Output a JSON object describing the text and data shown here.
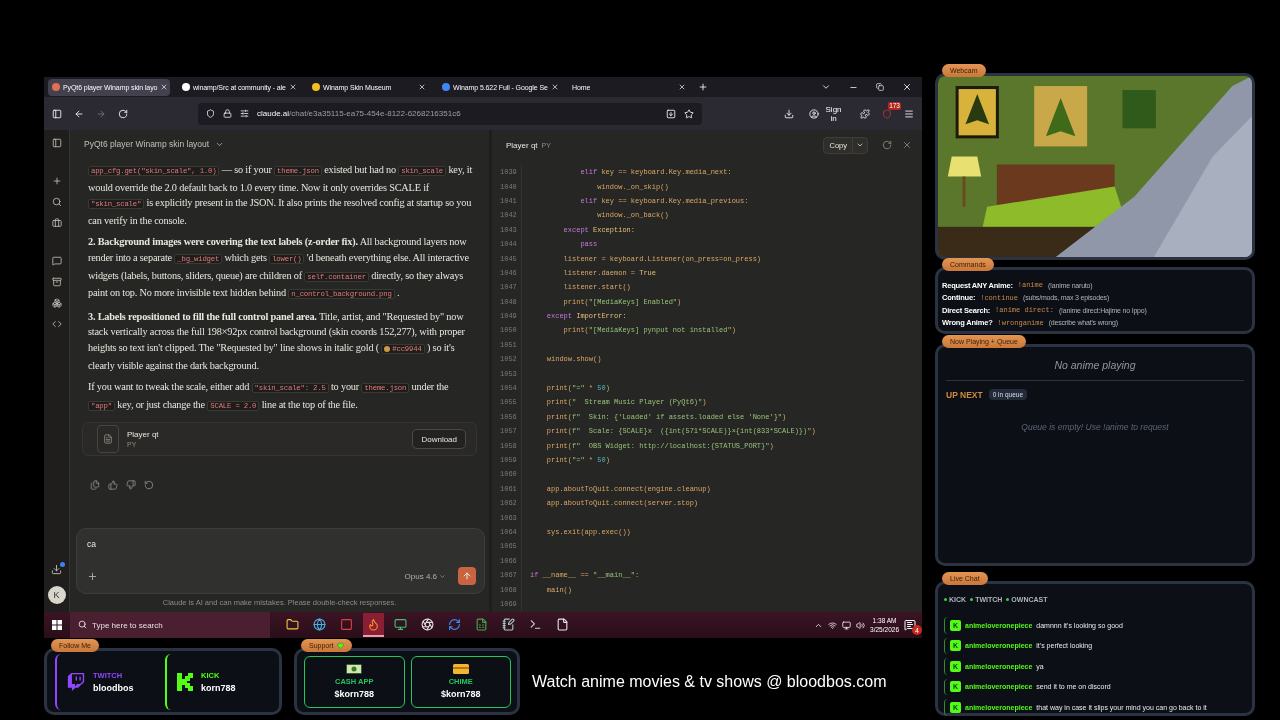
{
  "browser": {
    "tabs": [
      {
        "title": "PyQt6 player Winamp skin layo",
        "selected": true
      },
      {
        "title": "winamp/Src at community - ale",
        "selected": false
      },
      {
        "title": "Winamp Skin Museum",
        "selected": false
      },
      {
        "title": "Winamp 5.622 Full - Google Se",
        "selected": false
      },
      {
        "title": "Home",
        "selected": false
      }
    ],
    "address": {
      "host": "claude.ai",
      "path": "/chat/e3a35115-ea75-454e-8122-6268216351c6"
    },
    "sign_in": "Sign in",
    "extension_badge": "173"
  },
  "chat": {
    "title": "PyQt6 player Winamp skin layout",
    "paragraphs": [
      [
        {
          "text": "app_cfg.get(\"skin_scale\", 1.0)",
          "kind": "code"
        },
        {
          "text": " — so if your ",
          "kind": "text"
        },
        {
          "text": "theme.json",
          "kind": "code"
        },
        {
          "text": " existed but had no ",
          "kind": "text"
        },
        {
          "text": "skin_scale",
          "kind": "code"
        },
        {
          "text": " key, it would override the 2.0 default back to 1.0 every time. Now it only overrides SCALE if ",
          "kind": "text"
        },
        {
          "text": "\"skin_scale\"",
          "kind": "code"
        },
        {
          "text": " is explicitly present in the JSON. It also prints the resolved config at startup so you can verify in the console.",
          "kind": "text"
        }
      ],
      [
        {
          "text": "2. Background images were covering the text labels (z-order fix).",
          "kind": "bold"
        },
        {
          "text": " All background layers now render into a separate ",
          "kind": "text"
        },
        {
          "text": "_bg_widget",
          "kind": "code"
        },
        {
          "text": " which gets ",
          "kind": "text"
        },
        {
          "text": "lower()",
          "kind": "code"
        },
        {
          "text": " 'd beneath everything else. All interactive widgets (labels, buttons, sliders, queue) are children of ",
          "kind": "text"
        },
        {
          "text": "self.container",
          "kind": "code"
        },
        {
          "text": " directly, so they always paint on top. No more invisible text hidden behind ",
          "kind": "text"
        },
        {
          "text": "n_control_background.png",
          "kind": "code"
        },
        {
          "text": " .",
          "kind": "text"
        }
      ],
      [
        {
          "text": "3. Labels repositioned to fill the full control panel area.",
          "kind": "bold"
        },
        {
          "text": " Title, artist, and \"Requested by\" now stack vertically across the full 198×92px control background (skin coords 152,277), with proper heights so text isn't clipped. The \"Requested by\" line shows in italic gold ( ",
          "kind": "text"
        },
        {
          "text": "#cc9944",
          "kind": "swatch"
        },
        {
          "text": " ) so it's clearly visible against the dark background.",
          "kind": "text"
        }
      ],
      [
        {
          "text": "If you want to tweak the scale, either add ",
          "kind": "text"
        },
        {
          "text": "\"skin_scale\": 2.5",
          "kind": "code"
        },
        {
          "text": " to your ",
          "kind": "text"
        },
        {
          "text": "theme.json",
          "kind": "code"
        },
        {
          "text": " under the ",
          "kind": "text"
        },
        {
          "text": "\"app\"",
          "kind": "code"
        },
        {
          "text": " key, or just change the ",
          "kind": "text"
        },
        {
          "text": "SCALE = 2.0",
          "kind": "code"
        },
        {
          "text": " line at the top of the file.",
          "kind": "text"
        }
      ]
    ],
    "attachment": {
      "name": "Player qt",
      "type": "PY",
      "action": "Download"
    },
    "input": {
      "value": "ca",
      "model": "Opus 4.6"
    },
    "disclaimer": "Claude is AI and can make mistakes. Please double-check responses.",
    "avatar": "K"
  },
  "code_panel": {
    "title": "Player qt",
    "type": "PY",
    "copy": "Copy",
    "lines": [
      {
        "n": "1039",
        "tokens": [
          {
            "text": "            elif",
            "kind": "kw"
          },
          {
            "text": " key == keyboard.Key.media_next:",
            "kind": "id"
          }
        ]
      },
      {
        "n": "1040",
        "tokens": [
          {
            "text": "                window._on_skip()",
            "kind": "id"
          }
        ]
      },
      {
        "n": "1041",
        "tokens": [
          {
            "text": "            elif",
            "kind": "kw"
          },
          {
            "text": " key == keyboard.Key.media_previous:",
            "kind": "id"
          }
        ]
      },
      {
        "n": "1042",
        "tokens": [
          {
            "text": "                window._on_back()",
            "kind": "id"
          }
        ]
      },
      {
        "n": "1043",
        "tokens": [
          {
            "text": "        except",
            "kind": "kw"
          },
          {
            "text": " Exception:",
            "kind": "cls"
          }
        ]
      },
      {
        "n": "1044",
        "tokens": [
          {
            "text": "            pass",
            "kind": "kw"
          }
        ]
      },
      {
        "n": "1045",
        "tokens": [
          {
            "text": "        listener = keyboard.Listener(on_press=on_press)",
            "kind": "id"
          }
        ]
      },
      {
        "n": "1046",
        "tokens": [
          {
            "text": "        listener.daemon = ",
            "kind": "id"
          },
          {
            "text": "True",
            "kind": "cls"
          }
        ]
      },
      {
        "n": "1047",
        "tokens": [
          {
            "text": "        listener.start()",
            "kind": "id"
          }
        ]
      },
      {
        "n": "1048",
        "tokens": [
          {
            "text": "        print(",
            "kind": "id"
          },
          {
            "text": "\"[MediaKeys] Enabled\"",
            "kind": "str"
          },
          {
            "text": ")",
            "kind": "id"
          }
        ]
      },
      {
        "n": "1049",
        "tokens": [
          {
            "text": "    except",
            "kind": "kw"
          },
          {
            "text": " ImportError:",
            "kind": "cls"
          }
        ]
      },
      {
        "n": "1050",
        "tokens": [
          {
            "text": "        print(",
            "kind": "id"
          },
          {
            "text": "\"[MediaKeys] pynput not installed\"",
            "kind": "str"
          },
          {
            "text": ")",
            "kind": "id"
          }
        ]
      },
      {
        "n": "1051"
      },
      {
        "n": "1052",
        "tokens": [
          {
            "text": "    window.show()",
            "kind": "id"
          }
        ]
      },
      {
        "n": "1053"
      },
      {
        "n": "1054",
        "tokens": [
          {
            "text": "    print(",
            "kind": "id"
          },
          {
            "text": "\"=\"",
            "kind": "str"
          },
          {
            "text": " * ",
            "kind": "id"
          },
          {
            "text": "50",
            "kind": "num"
          },
          {
            "text": ")",
            "kind": "id"
          }
        ]
      },
      {
        "n": "1055",
        "tokens": [
          {
            "text": "    print(",
            "kind": "id"
          },
          {
            "text": "\"  Stream Music Player (PyQt6)\"",
            "kind": "str"
          },
          {
            "text": ")",
            "kind": "id"
          }
        ]
      },
      {
        "n": "1056",
        "tokens": [
          {
            "text": "    print(",
            "kind": "id"
          },
          {
            "text": "f\"  Skin: {'Loaded' if assets.loaded else 'None'}\"",
            "kind": "str"
          },
          {
            "text": ")",
            "kind": "id"
          }
        ]
      },
      {
        "n": "1057",
        "tokens": [
          {
            "text": "    print(",
            "kind": "id"
          },
          {
            "text": "f\"  Scale: {SCALE}x  ({int(571*SCALE)}×{int(833*SCALE)})\"",
            "kind": "str"
          },
          {
            "text": ")",
            "kind": "id"
          }
        ]
      },
      {
        "n": "1058",
        "tokens": [
          {
            "text": "    print(",
            "kind": "id"
          },
          {
            "text": "f\"  OBS Widget: http://localhost:{STATUS_PORT}\"",
            "kind": "str"
          },
          {
            "text": ")",
            "kind": "id"
          }
        ]
      },
      {
        "n": "1059",
        "tokens": [
          {
            "text": "    print(",
            "kind": "id"
          },
          {
            "text": "\"=\"",
            "kind": "str"
          },
          {
            "text": " * ",
            "kind": "id"
          },
          {
            "text": "50",
            "kind": "num"
          },
          {
            "text": ")",
            "kind": "id"
          }
        ]
      },
      {
        "n": "1060"
      },
      {
        "n": "1061",
        "tokens": [
          {
            "text": "    app.aboutToQuit.connect(engine.cleanup)",
            "kind": "id"
          }
        ]
      },
      {
        "n": "1062",
        "tokens": [
          {
            "text": "    app.aboutToQuit.connect(server.stop)",
            "kind": "id"
          }
        ]
      },
      {
        "n": "1063"
      },
      {
        "n": "1064",
        "tokens": [
          {
            "text": "    sys.exit(app.exec())",
            "kind": "id"
          }
        ]
      },
      {
        "n": "1065"
      },
      {
        "n": "1066"
      },
      {
        "n": "1067",
        "tokens": [
          {
            "text": "if",
            "kind": "kw"
          },
          {
            "text": " __name__ == ",
            "kind": "id"
          },
          {
            "text": "\"__main__\"",
            "kind": "str"
          },
          {
            "text": ":",
            "kind": "id"
          }
        ]
      },
      {
        "n": "1068",
        "tokens": [
          {
            "text": "    main()",
            "kind": "id"
          }
        ]
      },
      {
        "n": "1069"
      }
    ]
  },
  "taskbar": {
    "search_placeholder": "Type here to search",
    "apps": [
      {
        "kind": "folder",
        "selected": false
      },
      {
        "kind": "edge",
        "selected": false
      },
      {
        "kind": "voice",
        "selected": false
      },
      {
        "kind": "firefox",
        "selected": true
      },
      {
        "kind": "monitor",
        "selected": false
      },
      {
        "kind": "obs",
        "selected": false
      },
      {
        "kind": "refresh",
        "selected": false
      },
      {
        "kind": "sheet",
        "selected": false
      },
      {
        "kind": "notes",
        "selected": false
      },
      {
        "kind": "terminal",
        "selected": false
      },
      {
        "kind": "file",
        "selected": false
      }
    ],
    "time": "1:38 AM",
    "date": "3/25/2026",
    "notifications": "4"
  },
  "overlay": {
    "webcam": {
      "tag": "Webcam",
      "kind": "picture"
    },
    "commands": {
      "tag": "Commands",
      "rows": [
        {
          "label": "Request ANY Anime:",
          "command": "!anime",
          "hint": "(!anime naruto)"
        },
        {
          "label": "Continue:",
          "command": "!continue",
          "hint": "(subs/mods, max 3 episodes)"
        },
        {
          "label": "Direct Search:",
          "command": "!anime direct:",
          "hint": "(!anime direct:Hajime no Ippo)"
        },
        {
          "label": "Wrong Anime?",
          "command": "!wronganime",
          "hint": "(describe what's wrong)"
        }
      ]
    },
    "now_playing": {
      "tag": "Now Playing + Queue",
      "status": "No anime playing",
      "up_next": "UP NEXT",
      "queue_count": "0 in queue",
      "queue_empty": "Queue is empty! Use !anime to request"
    },
    "live_chat": {
      "tag": "Live Chat",
      "platforms": [
        "KICK",
        "TWITCH",
        "OWNCAST"
      ],
      "messages": [
        {
          "badge": "K",
          "user": "animeloveronepiece",
          "text": "damnnn it's looking so good"
        },
        {
          "badge": "K",
          "user": "animeloveronepiece",
          "text": "it's perfect looking"
        },
        {
          "badge": "K",
          "user": "animeloveronepiece",
          "text": "ya"
        },
        {
          "badge": "K",
          "user": "animeloveronepiece",
          "text": "send it to me on discord"
        },
        {
          "badge": "K",
          "user": "animeloveronepiece",
          "text": "that way in case it slips your mind you can go back to it"
        }
      ]
    },
    "follow": {
      "tag": "Follow Me",
      "cards": [
        {
          "kind": "twitch",
          "platform": "TWITCH",
          "handle": "bloodbos"
        },
        {
          "kind": "kick",
          "platform": "KICK",
          "handle": "korn788"
        }
      ]
    },
    "support": {
      "tag": "Support",
      "cards": [
        {
          "kind": "cashapp",
          "platform": "CASH APP",
          "handle": "$korn788"
        },
        {
          "kind": "chime",
          "platform": "CHIME",
          "handle": "$korn788"
        }
      ]
    },
    "tagline": "Watch anime movies & tv shows @ bloodbos.com"
  }
}
